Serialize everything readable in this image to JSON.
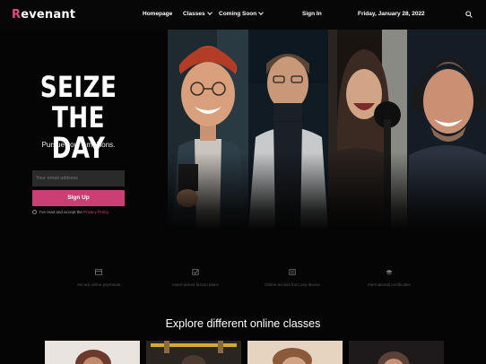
{
  "header": {
    "logo_initial": "R",
    "logo_rest": "evenant",
    "nav": [
      {
        "label": "Homepage"
      },
      {
        "label": "Classes"
      },
      {
        "label": "Coming Soon"
      }
    ],
    "signin_label": "Sign In",
    "date": "Friday, January 28, 2022"
  },
  "hero": {
    "title": "SEIZE THE DAY",
    "subtitle": "Pursue your ambitions.",
    "email_placeholder": "Your email address",
    "signup_label": "Sign Up",
    "terms_text": "I've read and accept the",
    "terms_link": "Privacy Policy."
  },
  "features": [
    {
      "icon": "credit-card-icon",
      "text": "Secure online payments"
    },
    {
      "icon": "checkbox-icon",
      "text": "Hand-picked lesson plans"
    },
    {
      "icon": "devices-icon",
      "text": "Online access from any device"
    },
    {
      "icon": "graduation-cap-icon",
      "text": "International certificates"
    }
  ],
  "explore": {
    "title": "Explore different online classes"
  },
  "colors": {
    "accent": "#cc3f75",
    "background": "#050505"
  }
}
